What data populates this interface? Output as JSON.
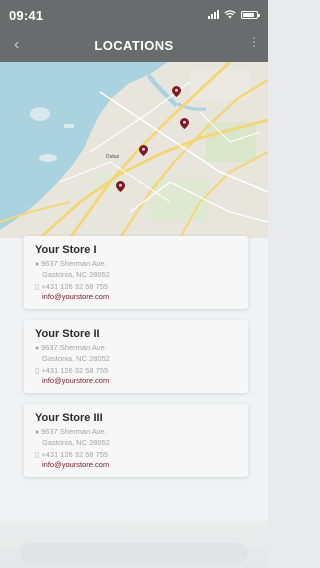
{
  "status_bar": {
    "time": "09:41"
  },
  "header": {
    "title": "LOCATIONS",
    "back_icon": "chevron-left-icon",
    "menu_icon": "more-vertical-icon"
  },
  "map": {
    "label": "Dubai"
  },
  "stores": [
    {
      "name": "Your Store I",
      "address_line1": "9637 Sherman Ave.",
      "address_line2": "Gastonia, NC 28052",
      "phone": "+431 126 32 58 755",
      "email": "info@yourstore.com"
    },
    {
      "name": "Your Store II",
      "address_line1": "9637 Sherman Ave.",
      "address_line2": "Gastonia, NC 28052",
      "phone": "+431 126 32 58 755",
      "email": "info@yourstore.com"
    },
    {
      "name": "Your Store III",
      "address_line1": "9637 Sherman Ave.",
      "address_line2": "Gastonia, NC 28052",
      "phone": "+431 126 32 58 755",
      "email": "info@yourstore.com"
    }
  ],
  "colors": {
    "header": "#6a6b6d",
    "accent": "#7b1a26",
    "water": "#aad3df"
  }
}
